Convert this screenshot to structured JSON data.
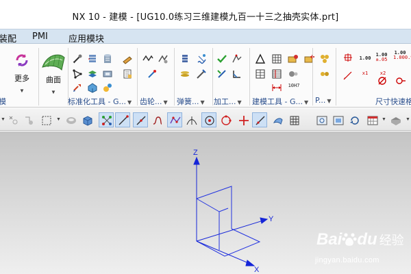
{
  "window": {
    "title": "NX 10 - 建模 - [UG10.0练习三维建模九百一十三之抽壳实体.prt]"
  },
  "menubar": {
    "items": [
      {
        "label": "装配"
      },
      {
        "label": "PMI"
      },
      {
        "label": "应用模块"
      }
    ]
  },
  "ribbon": {
    "more_label": "更多",
    "surface_label": "曲面",
    "groups": {
      "left_cut": "模",
      "standard_parts": "标准化工具 - G...",
      "gear": "齿轮...",
      "spring": "弹簧...",
      "machining": "加工...",
      "modeling_tools": "建模工具 - G...",
      "p_cut": "P...",
      "dimension_quick": "尺寸快速格"
    },
    "dim_labels": {
      "d1": "1.00",
      "d2_top": "1.00",
      "d2_bot": "±.05",
      "d3_top": "1.00",
      "d3_mid": "1.00",
      "d3_bot": "0.95",
      "h7": "10H7",
      "x1": "x1",
      "x2": "x2"
    }
  },
  "viewport": {
    "axes": {
      "z": "Z",
      "y": "Y",
      "x": "X"
    },
    "colors": {
      "axis": "#1525d8",
      "geometry": "#2233e0"
    }
  },
  "watermark": {
    "brand_bai": "Bai",
    "brand_du": "du",
    "suffix": "经验",
    "url": "jingyan.baidu.com"
  }
}
